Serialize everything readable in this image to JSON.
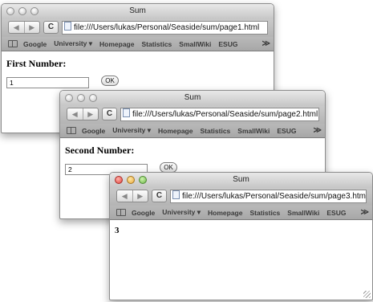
{
  "toolbar": {
    "back_icon": "back-arrow-icon",
    "forward_icon": "forward-arrow-icon",
    "back_glyph": "◀",
    "forward_glyph": "▶",
    "reload_glyph": "C"
  },
  "bookmarks": {
    "items": [
      "Google",
      "University ▾",
      "Homepage",
      "Statistics",
      "SmallWiki",
      "ESUG"
    ],
    "more_glyph": "≫"
  },
  "windows": [
    {
      "title": "Sum",
      "url": "file:///Users/lukas/Personal/Seaside/sum/page1.html",
      "label": "First Number:",
      "input_value": "1",
      "button_label": "OK"
    },
    {
      "title": "Sum",
      "url": "file:///Users/lukas/Personal/Seaside/sum/page2.html",
      "label": "Second Number:",
      "input_value": "2",
      "button_label": "OK"
    },
    {
      "title": "Sum",
      "url": "file:///Users/lukas/Personal/Seaside/sum/page3.html",
      "result": "3"
    }
  ]
}
